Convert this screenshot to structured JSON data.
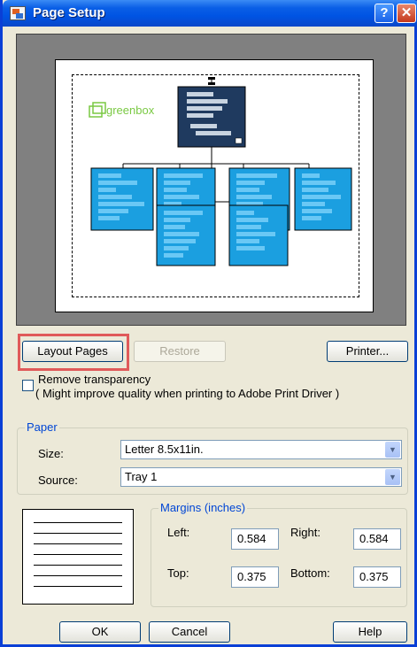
{
  "window": {
    "title": "Page Setup",
    "help_glyph": "?",
    "close_glyph": "✕"
  },
  "preview": {
    "logo_text": "greenbox"
  },
  "buttons": {
    "layout_pages": "Layout Pages",
    "restore": "Restore",
    "printer": "Printer...",
    "ok": "OK",
    "cancel": "Cancel",
    "help": "Help"
  },
  "transparency": {
    "label": "Remove transparency",
    "note": "( Might improve quality when printing to Adobe Print Driver )",
    "checked": false
  },
  "paper": {
    "group_label": "Paper",
    "size_label": "Size:",
    "size_value": "Letter 8.5x11in.",
    "source_label": "Source:",
    "source_value": "Tray 1"
  },
  "margins": {
    "group_label": "Margins (inches)",
    "left_label": "Left:",
    "left_value": "0.584",
    "right_label": "Right:",
    "right_value": "0.584",
    "top_label": "Top:",
    "top_value": "0.375",
    "bottom_label": "Bottom:",
    "bottom_value": "0.375"
  },
  "colors": {
    "node_dark": "#1f3a5f",
    "node_light": "#1b9fe0",
    "accent": "#0054e3"
  }
}
